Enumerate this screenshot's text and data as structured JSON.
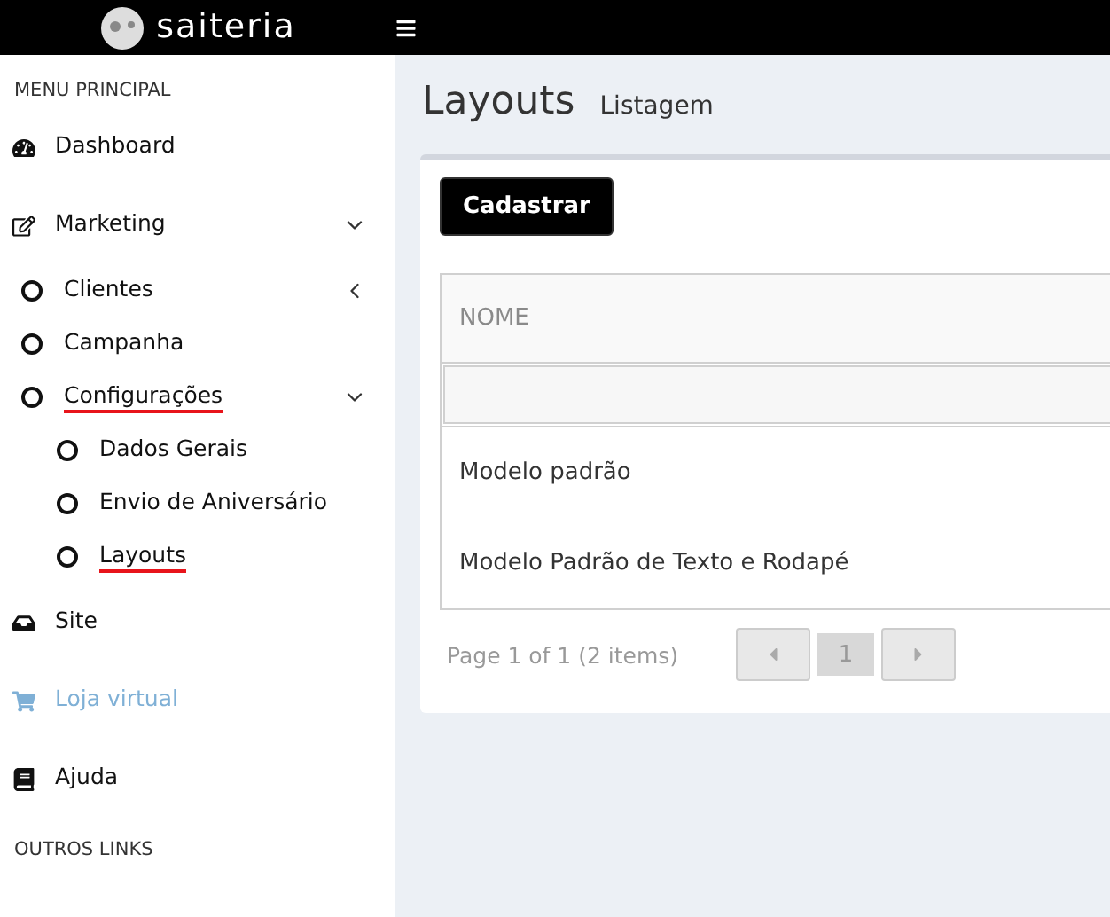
{
  "topbar": {
    "logo_text": "saiteria"
  },
  "sidebar": {
    "header": "MENU PRINCIPAL",
    "footer_header": "OUTROS LINKS",
    "items": [
      {
        "label": "Dashboard",
        "highlighted": false,
        "disabled": false
      },
      {
        "label": "Marketing",
        "highlighted": false,
        "disabled": false,
        "expanded": true,
        "children": [
          {
            "label": "Clientes",
            "highlighted": false,
            "expanded": false
          },
          {
            "label": "Campanha",
            "highlighted": false
          },
          {
            "label": "Configurações",
            "highlighted": true,
            "expanded": true,
            "children": [
              {
                "label": "Dados Gerais",
                "highlighted": false
              },
              {
                "label": "Envio de Aniversário",
                "highlighted": false
              },
              {
                "label": "Layouts",
                "highlighted": true
              }
            ]
          }
        ]
      },
      {
        "label": "Site",
        "highlighted": false,
        "disabled": false
      },
      {
        "label": "Loja virtual",
        "highlighted": false,
        "disabled": true
      },
      {
        "label": "Ajuda",
        "highlighted": false,
        "disabled": false
      }
    ]
  },
  "page": {
    "title": "Layouts",
    "subtitle": "Listagem"
  },
  "panel": {
    "button": "Cadastrar",
    "table": {
      "columns": [
        "NOME"
      ],
      "rows": [
        [
          "Modelo padrão"
        ],
        [
          "Modelo Padrão de Texto e Rodapé"
        ]
      ]
    },
    "pager": {
      "summary": "Page 1 of 1 (2 items)",
      "pages": [
        {
          "label": "1",
          "selected": true
        }
      ]
    }
  }
}
